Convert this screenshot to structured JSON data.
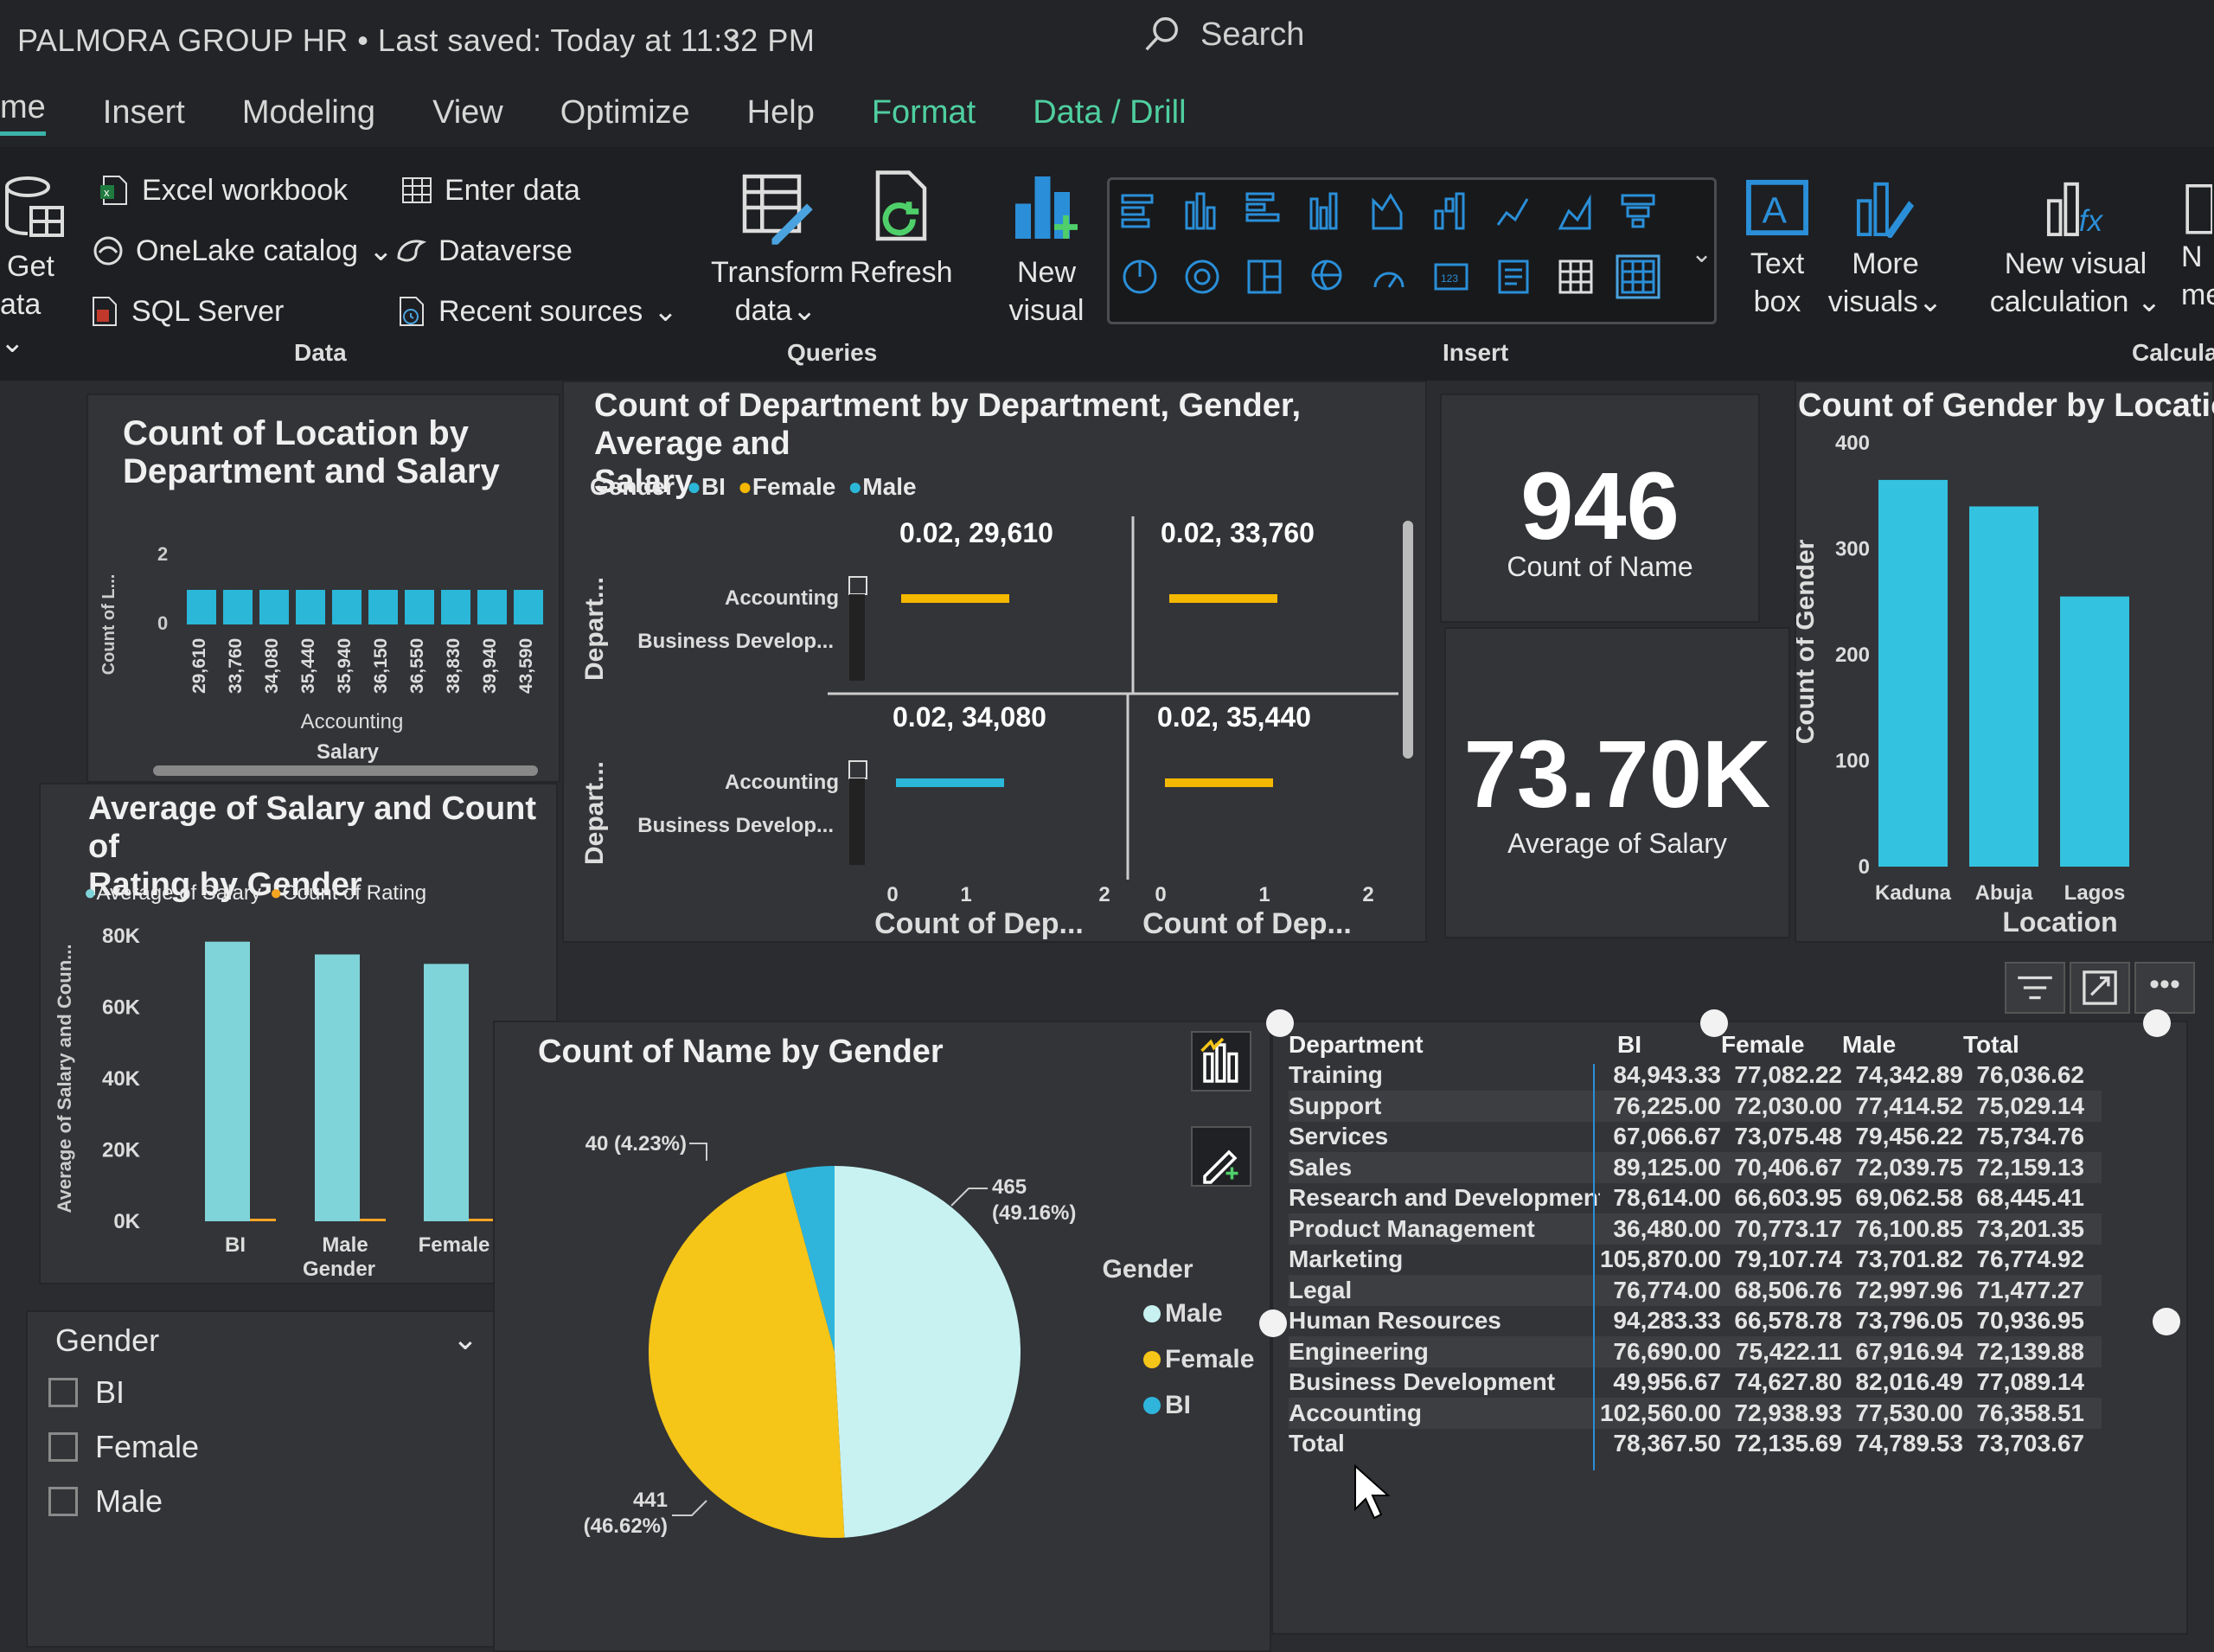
{
  "app": {
    "title": "PALMORA GROUP HR",
    "saved": "Last saved: Today at 11:32 PM",
    "search_label": "Search"
  },
  "menu": [
    "me",
    "Insert",
    "Modeling",
    "View",
    "Optimize",
    "Help",
    "Format",
    "Data / Drill"
  ],
  "ribbon": {
    "get_data_1": "Get",
    "get_data_2": "ata",
    "excel": "Excel workbook",
    "onelake": "OneLake catalog",
    "sql": "SQL Server",
    "enter_data": "Enter data",
    "dataverse": "Dataverse",
    "recent": "Recent sources",
    "transform_1": "Transform",
    "transform_2": "data",
    "refresh": "Refresh",
    "new_visual_1": "New",
    "new_visual_2": "visual",
    "text_box_1": "Text",
    "text_box_2": "box",
    "more_visuals_1": "More",
    "more_visuals_2": "visuals",
    "new_calc_1": "New visual",
    "new_calc_2": "calculation",
    "new_measure_1": "N",
    "new_measure_2": "mea",
    "group_data": "Data",
    "group_queries": "Queries",
    "group_insert": "Insert",
    "group_calc": "Calculat"
  },
  "visuals": {
    "location_dept": {
      "title_1": "Count of Location by",
      "title_2": "Department and Salary",
      "ylabel": "Count of L...",
      "xcat": "Accounting",
      "xlabel": "Salary"
    },
    "dept_gender": {
      "title_1": "Count of Department by Department, Gender, Average and",
      "title_2": "Salary",
      "legend_title": "Gender",
      "legend": [
        "BI",
        "Female",
        "Male"
      ],
      "cells": [
        {
          "label": "0.02, 29,610",
          "color": "#f5b800"
        },
        {
          "label": "0.02, 33,760",
          "color": "#f5b800"
        },
        {
          "label": "0.02, 34,080",
          "color": "#2ab7d8"
        },
        {
          "label": "0.02, 35,440",
          "color": "#f5b800"
        }
      ],
      "row_labels": [
        "Accounting",
        "Business Develop..."
      ],
      "ylabel": "Depart...",
      "xticks": [
        "0",
        "1",
        "2"
      ],
      "xlabel": "Count of Dep..."
    },
    "kpi_count": {
      "value": "946",
      "label": "Count of Name"
    },
    "kpi_salary": {
      "value": "73.70K",
      "label": "Average of Salary"
    },
    "gender_location": {
      "title": "Count of Gender by Location",
      "ylabel": "Count of Gender",
      "xlabel": "Location"
    },
    "salary_rating": {
      "title_1": "Average of Salary and Count of",
      "title_2": "Rating by Gender",
      "legend": [
        "Average of Salary",
        "Count of Rating"
      ],
      "ylabel": "Average of Salary and Coun...",
      "xlabel": "Gender"
    },
    "pie": {
      "title": "Count of Name by Gender",
      "legend_title": "Gender",
      "legend": [
        "Male",
        "Female",
        "BI"
      ],
      "labels": [
        {
          "line1": "465",
          "line2": "(49.16%)"
        },
        {
          "line1": "441",
          "line2": "(46.62%)"
        },
        {
          "line1": "40 (4.23%)",
          "line2": ""
        }
      ]
    },
    "slicer": {
      "title": "Gender",
      "options": [
        "BI",
        "Female",
        "Male"
      ]
    },
    "table": {
      "headers": [
        "Department",
        "BI",
        "Female",
        "Male",
        "Total"
      ],
      "rows": [
        [
          "Training",
          "84,943.33",
          "77,082.22",
          "74,342.89",
          "76,036.62"
        ],
        [
          "Support",
          "76,225.00",
          "72,030.00",
          "77,414.52",
          "75,029.14"
        ],
        [
          "Services",
          "67,066.67",
          "73,075.48",
          "79,456.22",
          "75,734.76"
        ],
        [
          "Sales",
          "89,125.00",
          "70,406.67",
          "72,039.75",
          "72,159.13"
        ],
        [
          "Research and Development",
          "78,614.00",
          "66,603.95",
          "69,062.58",
          "68,445.41"
        ],
        [
          "Product Management",
          "36,480.00",
          "70,773.17",
          "76,100.85",
          "73,201.35"
        ],
        [
          "Marketing",
          "105,870.00",
          "79,107.74",
          "73,701.82",
          "76,774.92"
        ],
        [
          "Legal",
          "76,774.00",
          "68,506.76",
          "72,997.96",
          "71,477.27"
        ],
        [
          "Human Resources",
          "94,283.33",
          "66,578.78",
          "73,796.05",
          "70,936.95"
        ],
        [
          "Engineering",
          "76,690.00",
          "75,422.11",
          "67,916.94",
          "72,139.88"
        ],
        [
          "Business Development",
          "49,956.67",
          "74,627.80",
          "82,016.49",
          "77,089.14"
        ],
        [
          "Accounting",
          "102,560.00",
          "72,938.93",
          "77,530.00",
          "76,358.51"
        ],
        [
          "Total",
          "78,367.50",
          "72,135.69",
          "74,789.53",
          "73,703.67"
        ]
      ]
    }
  },
  "chart_data": [
    {
      "type": "bar",
      "categories": [
        "29,610",
        "33,760",
        "34,080",
        "35,440",
        "35,940",
        "36,150",
        "36,550",
        "38,830",
        "39,940",
        "43,590"
      ],
      "values": [
        1,
        1,
        1,
        1,
        1,
        1,
        1,
        1,
        1,
        1
      ],
      "yticks": [
        "0",
        "2"
      ],
      "ylim": [
        0,
        2
      ],
      "xlabel": "Salary",
      "ylabel": "Count of L...",
      "group": "Accounting",
      "color": "#2ab7d8"
    },
    {
      "type": "bar",
      "categories": [
        "Kaduna",
        "Abuja",
        "Lagos"
      ],
      "values": [
        365,
        340,
        255
      ],
      "yticks": [
        "0",
        "100",
        "200",
        "300",
        "400"
      ],
      "ylim": [
        0,
        400
      ],
      "xlabel": "Location",
      "ylabel": "Count of Gender",
      "color": "#33c3e0"
    },
    {
      "type": "bar",
      "categories": [
        "BI",
        "Male",
        "Female"
      ],
      "series": [
        {
          "name": "Average of Salary",
          "values": [
            78367.5,
            74789.53,
            72135.69
          ],
          "color": "#7fd4d9"
        },
        {
          "name": "Count of Rating",
          "values": [
            0,
            0,
            0
          ],
          "color": "#f5a623"
        }
      ],
      "yticks": [
        "0K",
        "20K",
        "40K",
        "60K",
        "80K"
      ],
      "ylim": [
        0,
        80000
      ],
      "xlabel": "Gender",
      "ylabel": "Average of Salary and Coun..."
    },
    {
      "type": "pie",
      "categories": [
        "Male",
        "Female",
        "BI"
      ],
      "values": [
        465,
        441,
        40
      ],
      "colors": [
        "#c8f2f2",
        "#f5c518",
        "#2fb5dc"
      ]
    }
  ]
}
